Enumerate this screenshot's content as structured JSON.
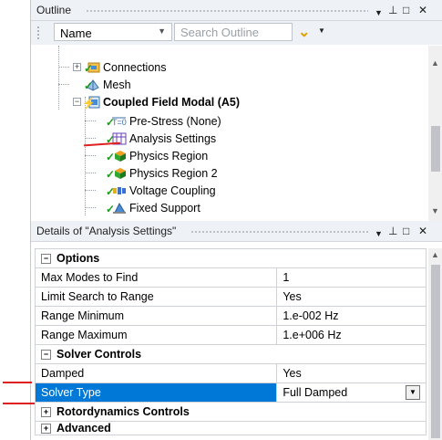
{
  "outline": {
    "title": "Outline",
    "controls": {
      "dropdown": "▼",
      "pin": "⊥",
      "maximize": "□",
      "close": "✕"
    },
    "filter_select": "Name",
    "search_placeholder": "Search Outline",
    "tree": [
      {
        "label": "Connections",
        "icon": "connections-icon",
        "bold": false
      },
      {
        "label": "Mesh",
        "icon": "mesh-icon",
        "bold": false
      },
      {
        "label": "Coupled Field Modal (A5)",
        "icon": "analysis-icon",
        "bold": true
      },
      {
        "label": "Pre-Stress (None)",
        "icon": "prestress-icon",
        "bold": false
      },
      {
        "label": "Analysis Settings",
        "icon": "analysis-settings-icon",
        "bold": false
      },
      {
        "label": "Physics Region",
        "icon": "physics-region-icon",
        "bold": false
      },
      {
        "label": "Physics Region 2",
        "icon": "physics-region-icon",
        "bold": false
      },
      {
        "label": "Voltage Coupling",
        "icon": "voltage-coupling-icon",
        "bold": false
      },
      {
        "label": "Fixed Support",
        "icon": "fixed-support-icon",
        "bold": false
      }
    ]
  },
  "details": {
    "title": "Details of \"Analysis Settings\"",
    "controls": {
      "dropdown": "▼",
      "pin": "⊥",
      "maximize": "□",
      "close": "✕"
    },
    "sections": {
      "options": "Options",
      "solver_controls": "Solver Controls",
      "rotordynamics": "Rotordynamics Controls",
      "advanced": "Advanced"
    },
    "rows": {
      "max_modes": {
        "key": "Max Modes to Find",
        "value": "1"
      },
      "limit_search": {
        "key": "Limit Search to Range",
        "value": "Yes"
      },
      "range_min": {
        "key": "Range Minimum",
        "value": "1.e-002 Hz"
      },
      "range_max": {
        "key": "Range Maximum",
        "value": "1.e+006 Hz"
      },
      "damped": {
        "key": "Damped",
        "value": "Yes"
      },
      "solver_type": {
        "key": "Solver Type",
        "value": "Full Damped"
      }
    }
  },
  "colors": {
    "selection": "#0078d7",
    "annotation": "#e02020",
    "check": "#1e9a1e"
  }
}
